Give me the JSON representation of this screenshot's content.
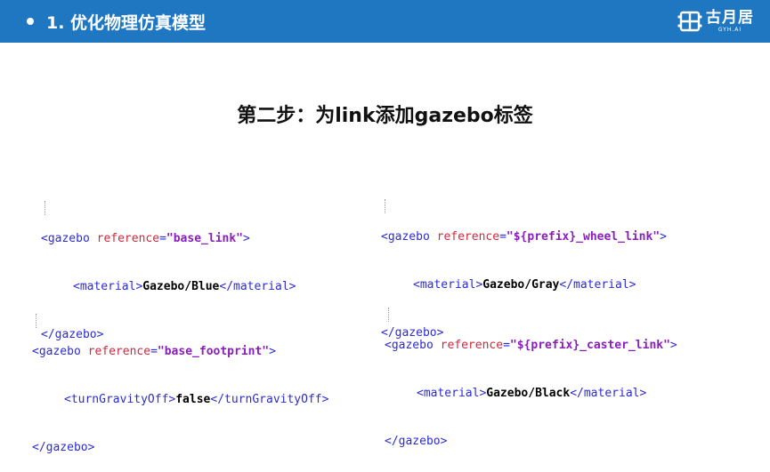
{
  "header": {
    "title": "1. 优化物理仿真模型",
    "brand": {
      "name_cn": "古月居",
      "name_en": "GYH.AI"
    }
  },
  "main": {
    "title": "第二步：为link添加gazebo标签",
    "blocks": [
      {
        "open": {
          "tag_open": "<gazebo",
          "attr": " reference",
          "eq": "=",
          "val": "\"base_link\"",
          "close": ">"
        },
        "inner": {
          "tag_open": "<material>",
          "text": "Gazebo/Blue",
          "tag_close": "</material>"
        },
        "end": "</gazebo>"
      },
      {
        "open": {
          "tag_open": "<gazebo",
          "attr": " reference",
          "eq": "=",
          "val": "\"${prefix}_wheel_link\"",
          "close": ">"
        },
        "inner": {
          "tag_open": "<material>",
          "text": "Gazebo/Gray",
          "tag_close": "</material>"
        },
        "end": "</gazebo>"
      },
      {
        "open": {
          "tag_open": "<gazebo",
          "attr": " reference",
          "eq": "=",
          "val": "\"base_footprint\"",
          "close": ">"
        },
        "inner": {
          "tag_open": "<turnGravityOff>",
          "text": "false",
          "tag_close": "</turnGravityOff>"
        },
        "end": "</gazebo>"
      },
      {
        "open": {
          "tag_open": "<gazebo",
          "attr": " reference",
          "eq": "=",
          "val": "\"${prefix}_caster_link\"",
          "close": ">"
        },
        "inner": {
          "tag_open": "<material>",
          "text": "Gazebo/Black",
          "tag_close": "</material>"
        },
        "end": "</gazebo>"
      }
    ]
  },
  "colors": {
    "header_bg": "#1f77c2",
    "xml_tag": "#2b2bd6",
    "xml_attr": "#d1283c",
    "xml_string": "#8a1dbd"
  }
}
